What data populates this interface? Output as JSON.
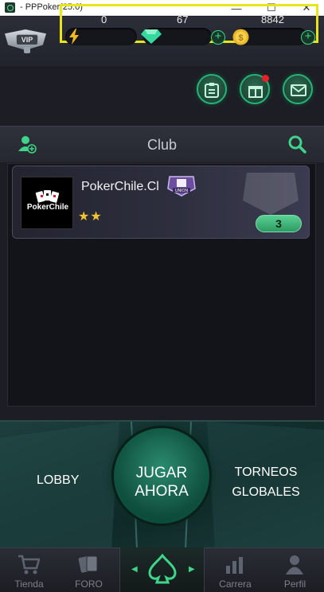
{
  "window": {
    "title": "- PPPoker(25.0)",
    "min_icon": "minimize-icon",
    "max_icon": "maximize-icon",
    "close_icon": "close-icon"
  },
  "topbar": {
    "vip_label": "VIP",
    "energy": {
      "value": "0",
      "icon": "lightning-icon"
    },
    "diamonds": {
      "value": "67",
      "icon": "diamond-icon"
    },
    "coins": {
      "value": "8842",
      "icon": "coin-icon"
    }
  },
  "actions": {
    "icons": [
      "clipboard-icon",
      "gift-icon",
      "mail-icon"
    ]
  },
  "club_header": {
    "title": "Club",
    "left_icon": "add-user-icon",
    "right_icon": "search-icon"
  },
  "club": {
    "name": "PokerChile.Cl",
    "logo_text": "PokerChile",
    "badge_text": "UNION",
    "rating": "★★",
    "count": "3"
  },
  "main": {
    "lobby": "LOBBY",
    "jugar_line1": "JUGAR",
    "jugar_line2": "AHORA",
    "torneos_line1": "TORNEOS",
    "torneos_line2": "GLOBALES"
  },
  "nav": {
    "items": [
      {
        "label": "Tienda",
        "icon": "cart-icon"
      },
      {
        "label": "FORO",
        "icon": "cards-icon"
      },
      {
        "label": "Carrera",
        "icon": "bar-chart-icon"
      },
      {
        "label": "Perfil",
        "icon": "person-icon"
      }
    ],
    "center_icon": "spade-icon"
  },
  "colors": {
    "accent": "#3fd48a",
    "highlight": "#e6e61a",
    "star": "#f2c233"
  }
}
